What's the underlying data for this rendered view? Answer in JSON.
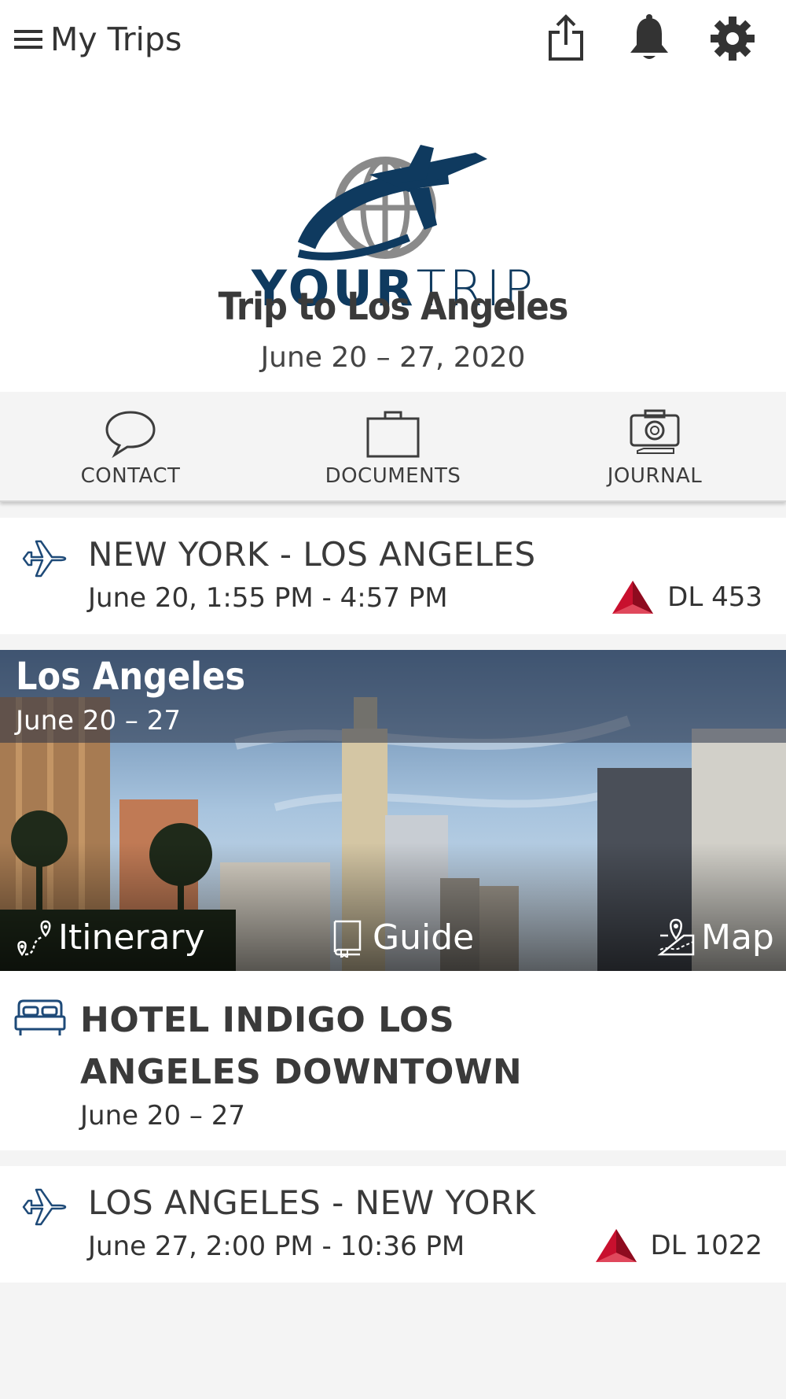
{
  "topbar": {
    "menu_label": "My Trips",
    "icons": [
      "menu-icon",
      "share-icon",
      "bell-icon",
      "gear-icon"
    ]
  },
  "header": {
    "logo_text_bold": "YOUR",
    "logo_text_light": "TRIP",
    "trip_title": "Trip to Los Angeles",
    "trip_dates": "June 20 – 27, 2020"
  },
  "actions": [
    {
      "label": "CONTACT",
      "icon": "speech-bubble-icon"
    },
    {
      "label": "DOCUMENTS",
      "icon": "briefcase-icon"
    },
    {
      "label": "JOURNAL",
      "icon": "camera-icon"
    }
  ],
  "flights": [
    {
      "route": "NEW YORK - LOS ANGELES",
      "time": "June 20, 1:55 PM - 4:57 PM",
      "flight_number": "DL 453",
      "icon": "airplane-icon"
    },
    {
      "route": "LOS ANGELES - NEW YORK",
      "time": "June 27, 2:00 PM - 10:36 PM",
      "flight_number": "DL 1022",
      "icon": "airplane-icon"
    }
  ],
  "destination": {
    "name": "Los Angeles",
    "dates": "June 20 – 27",
    "links": [
      {
        "label": "Itinerary",
        "icon": "route-icon"
      },
      {
        "label": "Guide",
        "icon": "book-icon"
      },
      {
        "label": "Map",
        "icon": "map-pin-icon"
      }
    ]
  },
  "hotel": {
    "name_line1": "HOTEL INDIGO LOS",
    "name_line2": "ANGELES DOWNTOWN",
    "dates": "June 20 – 27",
    "icon": "bed-icon"
  },
  "colors": {
    "brand_navy": "#0f3a5f",
    "brand_gray": "#8a8a8a",
    "icon_blue": "#1e4a78",
    "airline_red": "#c8102e",
    "background": "#f4f4f4"
  }
}
